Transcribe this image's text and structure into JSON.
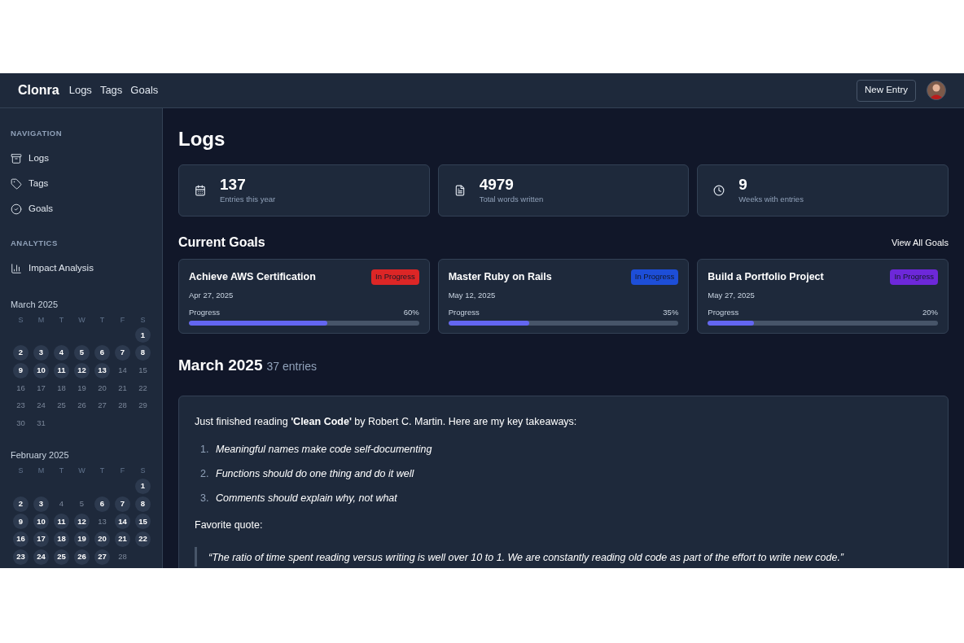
{
  "header": {
    "brand": "Clonra",
    "nav": [
      {
        "label": "Logs"
      },
      {
        "label": "Tags"
      },
      {
        "label": "Goals"
      }
    ],
    "new_entry": "New Entry"
  },
  "sidebar": {
    "sections": [
      {
        "heading": "NAVIGATION",
        "items": [
          {
            "kind": "logs",
            "label": "Logs"
          },
          {
            "kind": "tags",
            "label": "Tags"
          },
          {
            "kind": "goals",
            "label": "Goals"
          }
        ]
      },
      {
        "heading": "ANALYTICS",
        "items": [
          {
            "kind": "analytics",
            "label": "Impact Analysis"
          }
        ]
      }
    ],
    "calendars": [
      {
        "month": "March 2025",
        "weekdays": [
          "S",
          "M",
          "T",
          "W",
          "T",
          "F",
          "S"
        ],
        "weeks": [
          [
            {
              "day": "1",
              "active": true
            }
          ],
          [
            {
              "day": "2",
              "active": true
            },
            {
              "day": "3",
              "active": true
            },
            {
              "day": "4",
              "active": true
            },
            {
              "day": "5",
              "active": true
            },
            {
              "day": "6",
              "active": true
            },
            {
              "day": "7",
              "active": true
            },
            {
              "day": "8",
              "active": true
            }
          ],
          [
            {
              "day": "9",
              "active": true
            },
            {
              "day": "10",
              "active": true
            },
            {
              "day": "11",
              "active": true
            },
            {
              "day": "12",
              "active": true
            },
            {
              "day": "13",
              "active": true
            },
            {
              "day": "14",
              "active": false
            },
            {
              "day": "15",
              "active": false
            }
          ],
          [
            {
              "day": "16",
              "active": false
            },
            {
              "day": "17",
              "active": false
            },
            {
              "day": "18",
              "active": false
            },
            {
              "day": "19",
              "active": false
            },
            {
              "day": "20",
              "active": false
            },
            {
              "day": "21",
              "active": false
            },
            {
              "day": "22",
              "active": false
            }
          ],
          [
            {
              "day": "23",
              "active": false
            },
            {
              "day": "24",
              "active": false
            },
            {
              "day": "25",
              "active": false
            },
            {
              "day": "26",
              "active": false
            },
            {
              "day": "27",
              "active": false
            },
            {
              "day": "28",
              "active": false
            },
            {
              "day": "29",
              "active": false
            }
          ],
          [
            {
              "day": "30",
              "active": false
            },
            {
              "day": "31",
              "active": false
            }
          ]
        ]
      },
      {
        "month": "February 2025",
        "weekdays": [
          "S",
          "M",
          "T",
          "W",
          "T",
          "F",
          "S"
        ],
        "weeks": [
          [
            {
              "day": "1",
              "active": true
            }
          ],
          [
            {
              "day": "2",
              "active": true
            },
            {
              "day": "3",
              "active": true
            },
            {
              "day": "4",
              "active": false
            },
            {
              "day": "5",
              "active": false
            },
            {
              "day": "6",
              "active": true
            },
            {
              "day": "7",
              "active": true
            },
            {
              "day": "8",
              "active": true
            }
          ],
          [
            {
              "day": "9",
              "active": true
            },
            {
              "day": "10",
              "active": true
            },
            {
              "day": "11",
              "active": true
            },
            {
              "day": "12",
              "active": true
            },
            {
              "day": "13",
              "active": false
            },
            {
              "day": "14",
              "active": true
            },
            {
              "day": "15",
              "active": true
            }
          ],
          [
            {
              "day": "16",
              "active": true
            },
            {
              "day": "17",
              "active": true
            },
            {
              "day": "18",
              "active": true
            },
            {
              "day": "19",
              "active": true
            },
            {
              "day": "20",
              "active": true
            },
            {
              "day": "21",
              "active": true
            },
            {
              "day": "22",
              "active": true
            }
          ],
          [
            {
              "day": "23",
              "active": true
            },
            {
              "day": "24",
              "active": true
            },
            {
              "day": "25",
              "active": true
            },
            {
              "day": "26",
              "active": true
            },
            {
              "day": "27",
              "active": true
            },
            {
              "day": "28",
              "active": false
            }
          ]
        ]
      }
    ]
  },
  "main": {
    "title": "Logs",
    "stats": [
      {
        "kind": "calendar",
        "value": "137",
        "label": "Entries this year"
      },
      {
        "kind": "document",
        "value": "4979",
        "label": "Total words written"
      },
      {
        "kind": "clock",
        "value": "9",
        "label": "Weeks with entries"
      }
    ],
    "goals_heading": "Current Goals",
    "view_all": "View All Goals",
    "goals": [
      {
        "title": "Achieve AWS Certification",
        "status": "In Progress",
        "color": "#dc2626",
        "date": "Apr 27, 2025",
        "progress_label": "Progress",
        "percent": "60%",
        "level": 0.6
      },
      {
        "title": "Master Ruby on Rails",
        "status": "In Progress",
        "color": "#1d4ed8",
        "date": "May 12, 2025",
        "progress_label": "Progress",
        "percent": "35%",
        "level": 0.35
      },
      {
        "title": "Build a Portfolio Project",
        "status": "In Progress",
        "color": "#6d28d9",
        "date": "May 27, 2025",
        "progress_label": "Progress",
        "percent": "20%",
        "level": 0.2
      }
    ],
    "month_heading": "March 2025",
    "month_count": "37 entries",
    "entry": {
      "intro": "Just finished reading **'Clean Code'** by Robert C. Martin. Here are my key takeaways:",
      "list": [
        {
          "marker": "1.",
          "text": "Meaningful names make code self-documenting"
        },
        {
          "marker": "2.",
          "text": "Functions should do one thing and do it well"
        },
        {
          "marker": "3.",
          "text": "Comments should explain why, not what"
        }
      ],
      "quote_label": "Favorite quote:",
      "quote": "“The ratio of time spent reading versus writing is well over 10 to 1. We are constantly reading old code as part of the effort to write new code.”"
    }
  }
}
